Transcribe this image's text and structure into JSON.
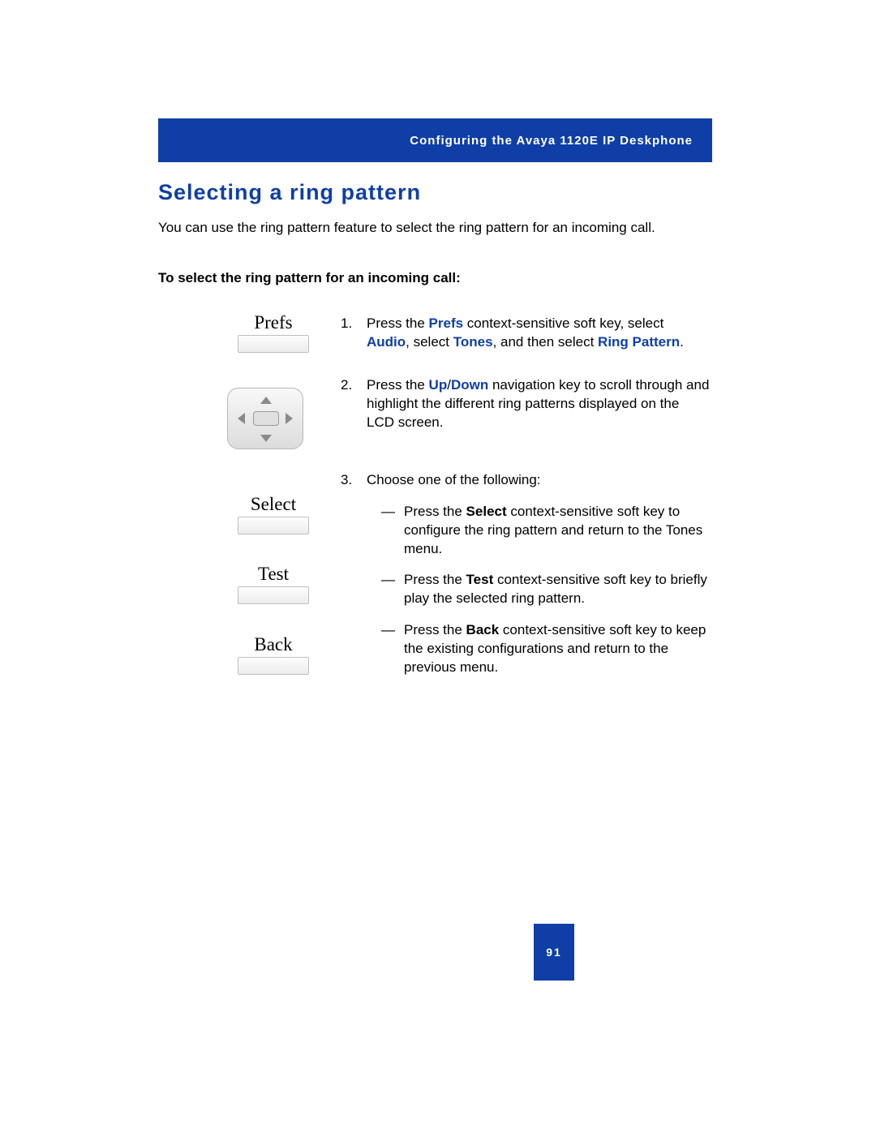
{
  "header": "Configuring the Avaya 1120E IP Deskphone",
  "title": "Selecting a ring pattern",
  "intro": "You can use the ring pattern feature to select the ring pattern for an incoming call.",
  "subhead": "To select the ring pattern for an incoming call:",
  "softkeys": {
    "prefs": "Prefs",
    "select": "Select",
    "test": "Test",
    "back": "Back"
  },
  "steps": {
    "s1": {
      "num": "1.",
      "p1a": "Press the ",
      "k1": "Prefs",
      "p1b": " context-sensitive soft key, select ",
      "k2": "Audio",
      "p1c": ", select ",
      "k3": "Tones",
      "p1d": ", and then select ",
      "k4": "Ring Pattern",
      "p1e": "."
    },
    "s2": {
      "num": "2.",
      "p1a": "Press the ",
      "k1": "Up",
      "sep": "/",
      "k2": "Down",
      "p1b": " navigation key to scroll through and highlight the different ring patterns displayed on the LCD screen."
    },
    "s3": {
      "num": "3.",
      "lead": "Choose one of the following:",
      "a": {
        "dash": "—",
        "p1a": "Press the ",
        "k1": "Select",
        "p1b": " context-sensitive soft key to configure the ring pattern and return to the Tones menu."
      },
      "b": {
        "dash": "—",
        "p1a": "Press the ",
        "k1": "Test",
        "p1b": " context-sensitive soft key to briefly play the selected ring pattern."
      },
      "c": {
        "dash": "—",
        "p1a": "Press the ",
        "k1": "Back",
        "p1b": " context-sensitive soft key to keep the existing configurations and return to the previous menu."
      }
    }
  },
  "page_number": "91"
}
